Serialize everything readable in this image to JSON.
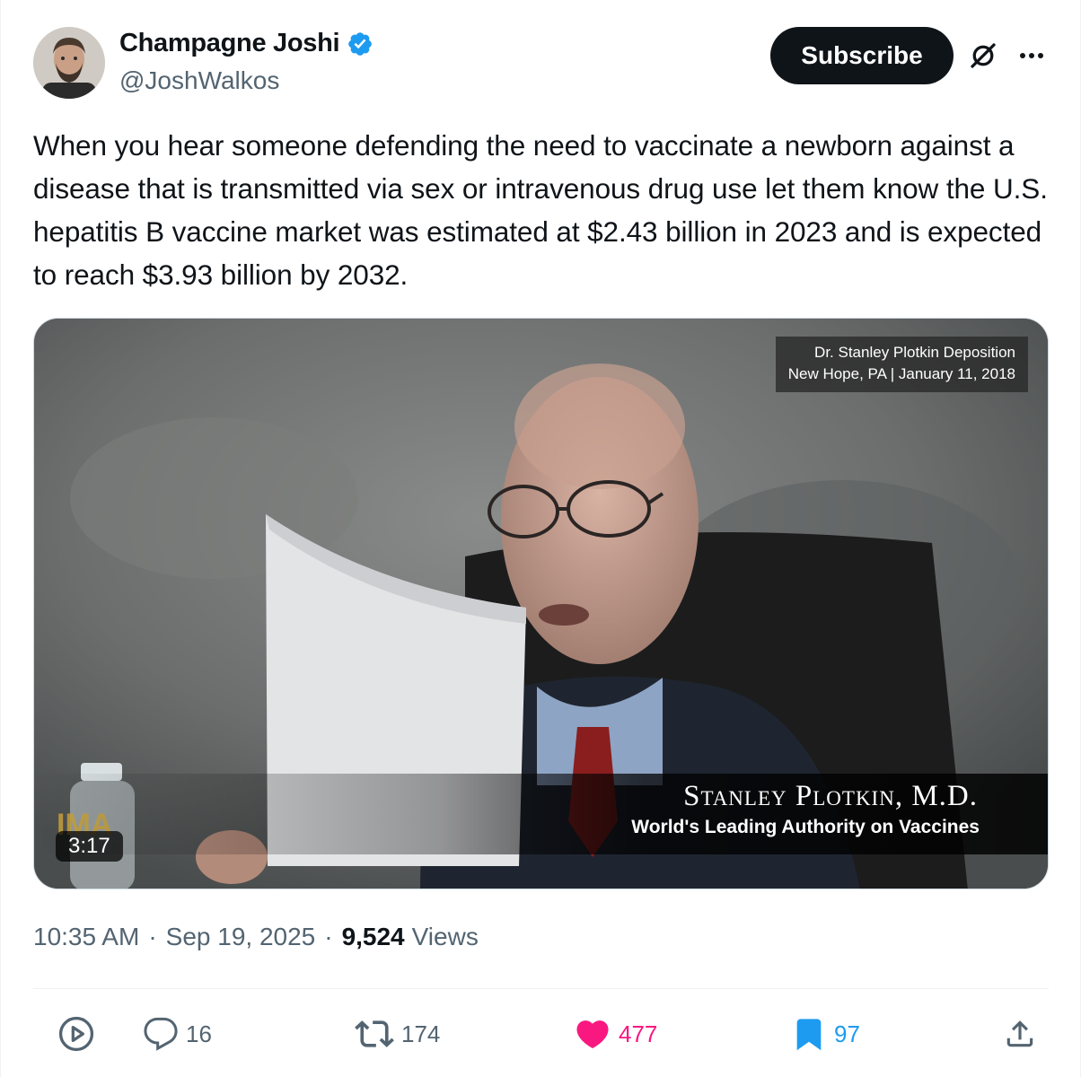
{
  "author": {
    "display_name": "Champagne Joshi",
    "handle": "@JoshWalkos",
    "verified": true
  },
  "header": {
    "subscribe_label": "Subscribe",
    "icons": [
      "verified-badge-icon",
      "grok-icon",
      "more-icon"
    ]
  },
  "tweet": {
    "text": "When you hear someone defending the need to vaccinate a newborn against a disease that is transmitted via sex or intravenous drug use let them know the U.S. hepatitis B vaccine market was estimated at $2.43 billion in 2023 and is expected to reach $3.93 billion by 2032."
  },
  "media": {
    "caption_top_line1": "Dr. Stanley Plotkin Deposition",
    "caption_top_line2": "New Hope, PA  |  January 11, 2018",
    "lower_name": "Stanley Plotkin, M.D.",
    "lower_title": "World's Leading Authority on Vaccines",
    "duration": "3:17"
  },
  "meta": {
    "time": "10:35 AM",
    "date": "Sep 19, 2025",
    "separator": "·",
    "views_count": "9,524",
    "views_label": "Views"
  },
  "actions": {
    "replies": "16",
    "retweets": "174",
    "likes": "477",
    "bookmarks": "97"
  },
  "colors": {
    "text_primary": "#0f1419",
    "text_secondary": "#536471",
    "accent_blue": "#1d9bf0",
    "like_pink": "#f91880"
  }
}
